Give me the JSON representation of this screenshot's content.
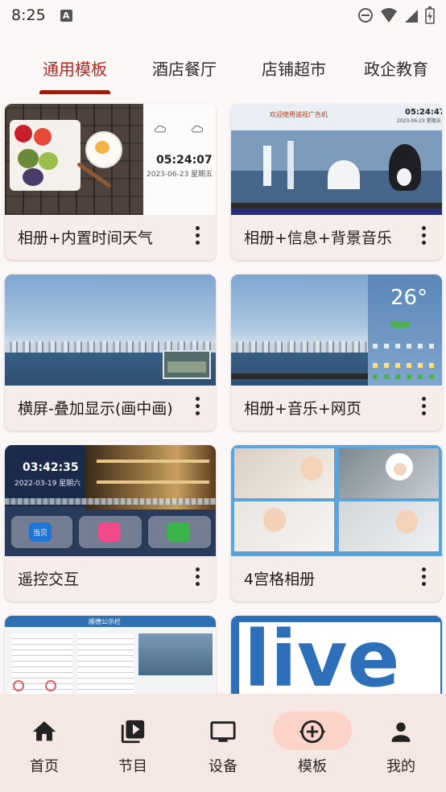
{
  "status_bar": {
    "time": "8:25",
    "notification_letter": "A"
  },
  "tabs": [
    {
      "label": "通用模板",
      "active": true
    },
    {
      "label": "酒店餐厅",
      "active": false
    },
    {
      "label": "店铺超市",
      "active": false
    },
    {
      "label": "政企教育",
      "active": false
    }
  ],
  "cards": [
    {
      "title": "相册+内置时间天气",
      "thumb_time": "05:24:07",
      "thumb_date": "2023-06-23 星期五"
    },
    {
      "title": "相册+信息+背景音乐",
      "thumb_heading": "欢迎使用诚视广告机",
      "thumb_time": "05:24:47",
      "thumb_date": "2023-06-23 星期五"
    },
    {
      "title": "横屏-叠加显示(画中画)"
    },
    {
      "title": "相册+音乐+网页",
      "thumb_temp": "26°"
    },
    {
      "title": "遥控交互",
      "thumb_time": "03:42:35",
      "thumb_date": "2022-03-19 星期六",
      "thumb_app1": "当贝"
    },
    {
      "title": "4宫格相册"
    },
    {
      "title": "",
      "thumb_heading": "顺德公示栏"
    },
    {
      "title": "",
      "thumb_word": "live"
    }
  ],
  "bottom_nav": [
    {
      "label": "首页",
      "icon": "home-icon",
      "active": false
    },
    {
      "label": "节目",
      "icon": "video-library-icon",
      "active": false
    },
    {
      "label": "设备",
      "icon": "monitor-icon",
      "active": false
    },
    {
      "label": "模板",
      "icon": "add-circle-icon",
      "active": true
    },
    {
      "label": "我的",
      "icon": "person-icon",
      "active": false
    }
  ],
  "colors": {
    "accent": "#b3261e",
    "indicator": "#9a1c0d",
    "nav_pill": "#fbd3c9",
    "nav_bg": "#f4e7e4",
    "card_bg": "#f6ece9"
  }
}
